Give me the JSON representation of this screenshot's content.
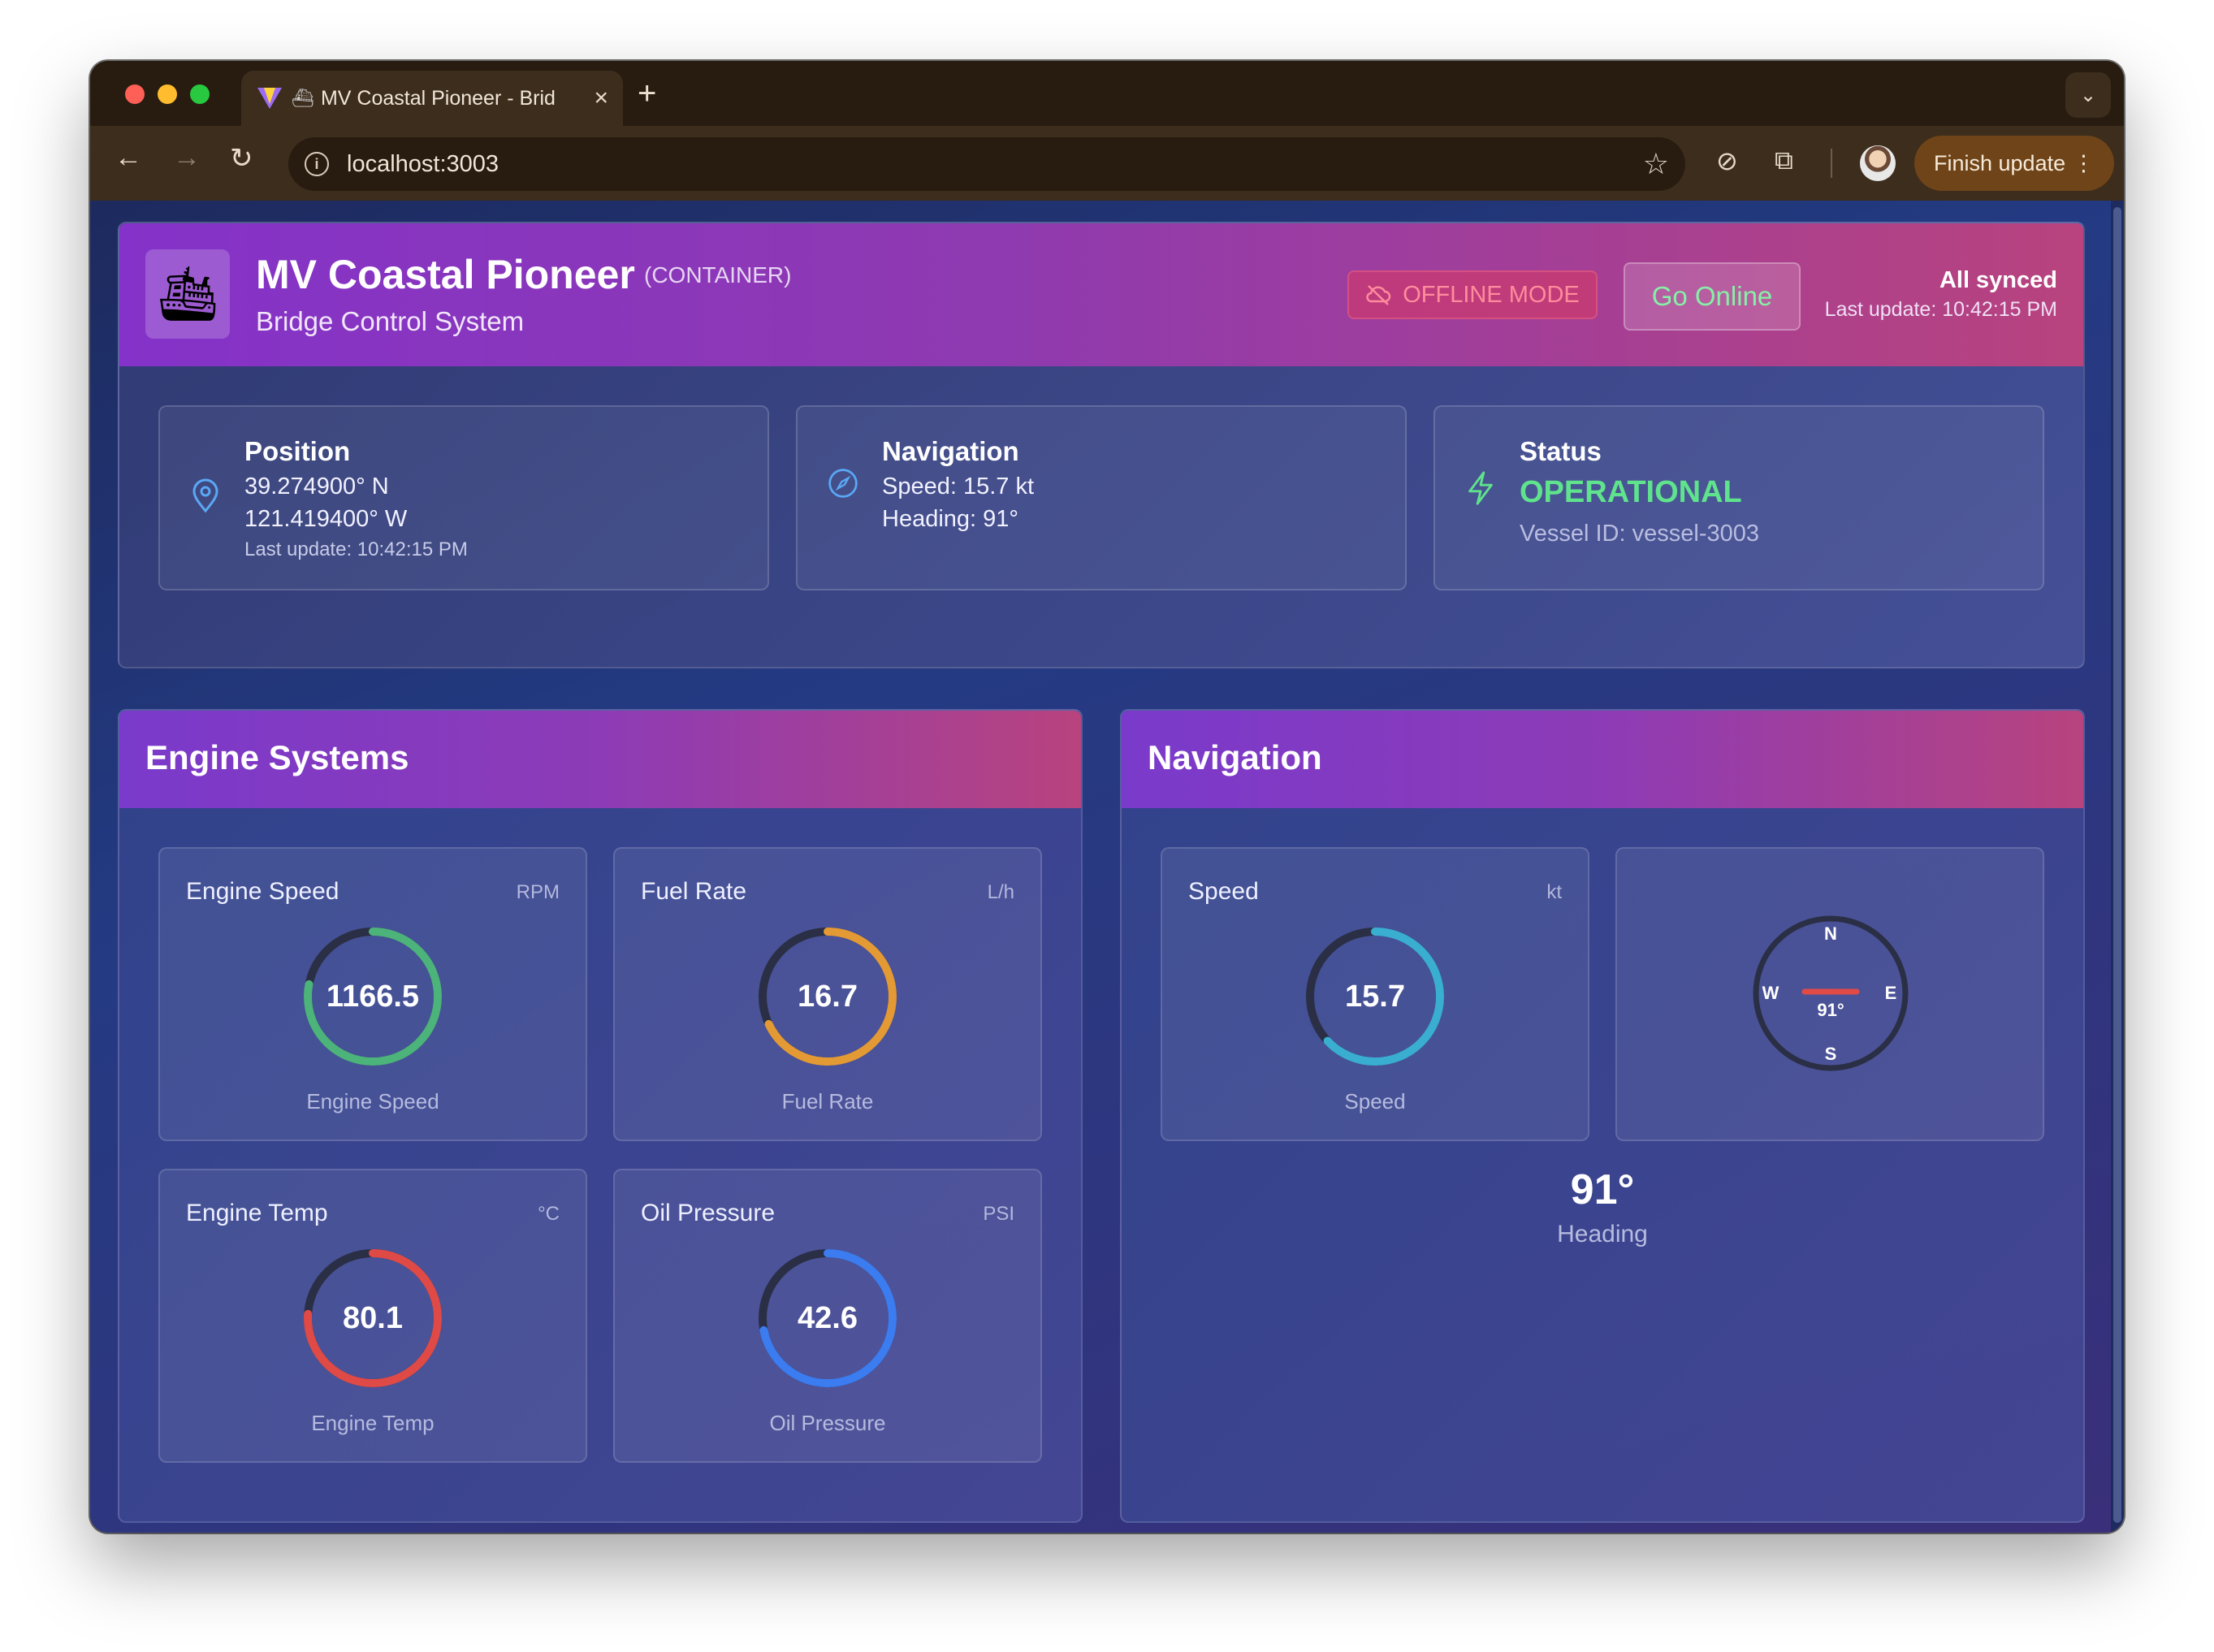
{
  "browser": {
    "tab_title": "MV Coastal Pioneer - Bridge Control System",
    "tab_title_visible": "MV Coastal Pioneer - Brid",
    "new_tab": "+",
    "url": "localhost:3003",
    "finish_update": "Finish update"
  },
  "header": {
    "vessel_name": "MV Coastal Pioneer",
    "vessel_type": "(CONTAINER)",
    "subtitle": "Bridge Control System",
    "offline_label": "OFFLINE MODE",
    "go_online_label": "Go Online",
    "sync_title": "All synced",
    "sync_time": "Last update: 10:42:15 PM"
  },
  "info_cards": {
    "position": {
      "title": "Position",
      "lat": "39.274900° N",
      "lon": "121.419400° W",
      "updated": "Last update: 10:42:15 PM"
    },
    "navigation": {
      "title": "Navigation",
      "speed": "Speed: 15.7 kt",
      "heading": "Heading: 91°"
    },
    "status": {
      "title": "Status",
      "value": "OPERATIONAL",
      "vessel_id": "Vessel ID: vessel-3003"
    }
  },
  "engine": {
    "title": "Engine Systems",
    "gauges": [
      {
        "label": "Engine Speed",
        "unit": "RPM",
        "value": "1166.5",
        "caption": "Engine Speed",
        "fraction": 0.78,
        "color": "#4cb37a"
      },
      {
        "label": "Fuel Rate",
        "unit": "L/h",
        "value": "16.7",
        "caption": "Fuel Rate",
        "fraction": 0.68,
        "color": "#e49a34"
      },
      {
        "label": "Engine Temp",
        "unit": "°C",
        "value": "80.1",
        "caption": "Engine Temp",
        "fraction": 0.76,
        "color": "#df4a46"
      },
      {
        "label": "Oil Pressure",
        "unit": "PSI",
        "value": "42.6",
        "caption": "Oil Pressure",
        "fraction": 0.72,
        "color": "#3b7cf0"
      }
    ]
  },
  "navigation": {
    "title": "Navigation",
    "speed_gauge": {
      "label": "Speed",
      "unit": "kt",
      "value": "15.7",
      "caption": "Speed",
      "fraction": 0.63,
      "color": "#3aaed0"
    },
    "compass": {
      "n": "N",
      "e": "E",
      "s": "S",
      "w": "W",
      "value": "91°"
    },
    "heading_value": "91°",
    "heading_caption": "Heading"
  }
}
